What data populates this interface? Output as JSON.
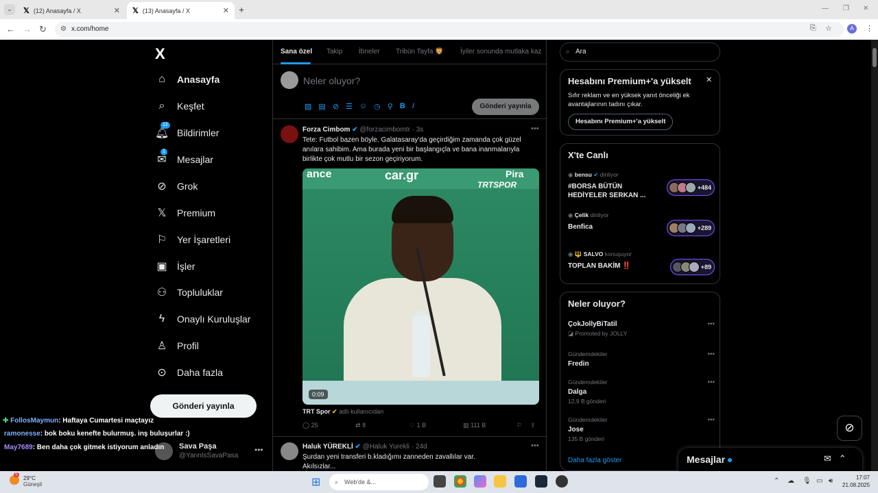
{
  "browser": {
    "tabs": [
      {
        "title": "(12) Anasayfa / X"
      },
      {
        "title": "(13) Anasayfa / X"
      }
    ],
    "url": "x.com/home",
    "profile_initial": "A"
  },
  "sidebar": {
    "logo": "X",
    "items": [
      {
        "label": "Anasayfa",
        "icon": "home-icon",
        "active": true
      },
      {
        "label": "Keşfet",
        "icon": "search-icon"
      },
      {
        "label": "Bildirimler",
        "icon": "bell-icon",
        "badge": "12"
      },
      {
        "label": "Mesajlar",
        "icon": "mail-icon",
        "badge": "1"
      },
      {
        "label": "Grok",
        "icon": "grok-icon"
      },
      {
        "label": "Premium",
        "icon": "x-icon"
      },
      {
        "label": "Yer İşaretleri",
        "icon": "bookmark-icon"
      },
      {
        "label": "İşler",
        "icon": "briefcase-icon"
      },
      {
        "label": "Topluluklar",
        "icon": "people-icon"
      },
      {
        "label": "Onaylı Kuruluşlar",
        "icon": "lightning-icon"
      },
      {
        "label": "Profil",
        "icon": "person-icon"
      },
      {
        "label": "Daha fazla",
        "icon": "more-circle-icon"
      }
    ],
    "post_button": "Gönderi yayınla",
    "profile": {
      "name": "Sava Paşa",
      "handle": "@YannIsSavaPasa"
    }
  },
  "chat_overlay": [
    {
      "user": "FollosMaymun",
      "text": ": Haftaya Cumartesi maçtayız"
    },
    {
      "user": "ramonesse",
      "text": ": bok boku kenefte bulurmuş. inş buluşurlar :)"
    },
    {
      "user": "May7689",
      "text": ": Ben daha çok gitmek istiyorum anladın"
    }
  ],
  "feed": {
    "tabs": [
      "Sana özel",
      "Takip",
      "İbneler",
      "Tribün Tayfa 🦁",
      "İyiler sonunda mutlaka kaz"
    ],
    "compose_placeholder": "Neler oluyor?",
    "compose_button": "Gönderi yayınla",
    "tweet1": {
      "name": "Forza Cimbom",
      "handle": "@forzacimbomtr",
      "time": "· 3s",
      "text": "Tete: Futbol bazen böyle. Galatasaray'da geçirdiğim zamanda çok güzel anılara sahibim. Ama burada yeni bir başlangıçla ve bana inanmalarıyla birlikte çok mutlu bir sezon geçiriyorum.",
      "video_time": "0:09",
      "video_wall_text": [
        "ance",
        "car.gr",
        "Pira",
        "TRTSPOR"
      ],
      "source_name": "TRT Spor",
      "source_sub": "adlı kullanıcıdan",
      "replies": "25",
      "retweets": "8",
      "likes": "1 B",
      "views": "111 B"
    },
    "tweet2": {
      "name": "Haluk YÜREKLİ",
      "handle": "@Haluk Yurekli",
      "time": "· 24d",
      "text": "Şurdan yeni transferi b.kladığımı zanneden zavallılar var. Akılsızlar..."
    }
  },
  "right": {
    "search_placeholder": "Ara",
    "premium": {
      "title": "Hesabını Premium+'a yükselt",
      "desc": "Sıfır reklam ve en yüksek yanıt önceliği ek avantajlarının tadını çıkar.",
      "button": "Hesabını Premium+'a yükselt"
    },
    "live": {
      "title": "X'te Canlı",
      "items": [
        {
          "host": "bensu",
          "status": "dinliyor",
          "topic": "#BORSA BÜTÜN HEDİYELER SERKAN ...",
          "count": "+484"
        },
        {
          "host": "Çelik",
          "status": "dinliyor",
          "topic": "Benfica",
          "count": "+289"
        },
        {
          "host": "🔱 SALVO",
          "status": "konuşuyor",
          "topic": "TOPLAN BAKİM ‼️",
          "count": "+89"
        }
      ]
    },
    "trends": {
      "title": "Neler oluyor?",
      "items": [
        {
          "category": "",
          "name": "ÇokJollyBiTatil",
          "sub": "Promoted by JOLLY"
        },
        {
          "category": "Gündemdekiler",
          "name": "Fredin",
          "sub": ""
        },
        {
          "category": "Gündemdekiler",
          "name": "Dalga",
          "sub": "12,9 B gönderi"
        },
        {
          "category": "Gündemdekiler",
          "name": "Jose",
          "sub": "135 B gönderi"
        }
      ],
      "show_more": "Daha fazla göster"
    },
    "messages_title": "Mesajlar"
  },
  "taskbar": {
    "weather_temp": "29°C",
    "weather_desc": "Güneşli",
    "weather_badge": "5",
    "search_placeholder": "Web'de &...",
    "time": "17:07",
    "date": "21.08.2025"
  },
  "colors": {
    "accent": "#1d9bf0",
    "background": "#000000",
    "live_border": "#7856ff"
  }
}
